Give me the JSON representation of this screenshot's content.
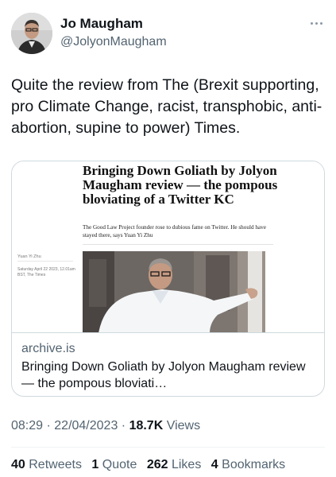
{
  "author": {
    "name": "Jo Maugham",
    "handle": "@JolyonMaugham"
  },
  "tweet": {
    "text": "Quite the review from The (Brexit supporting, pro Climate Change, racist, transphobic, anti-abortion, supine to power) Times."
  },
  "card": {
    "image": {
      "headline": "Bringing Down Goliath by Jolyon Maugham review — the pompous bloviating of a Twitter KC",
      "standfirst": "The Good Law Project founder rose to dubious fame on Twitter. He should have stayed there, says Yuan Yi Zhu",
      "byline": "Yuan Yi Zhu",
      "dateline": "Saturday April 22 2023, 12.01am BST, The Times"
    },
    "domain": "archive.is",
    "title": "Bringing Down Goliath by Jolyon Maugham review — the pompous bloviati…"
  },
  "meta": {
    "time": "08:29",
    "date": "22/04/2023",
    "views_count": "18.7K",
    "views_label": "Views"
  },
  "stats": {
    "retweets_count": "40",
    "retweets_label": "Retweets",
    "quotes_count": "1",
    "quotes_label": "Quote",
    "likes_count": "262",
    "likes_label": "Likes",
    "bookmarks_count": "4",
    "bookmarks_label": "Bookmarks"
  },
  "colors": {
    "text": "#0f1419",
    "secondary": "#536471",
    "border": "#cfd9de"
  }
}
